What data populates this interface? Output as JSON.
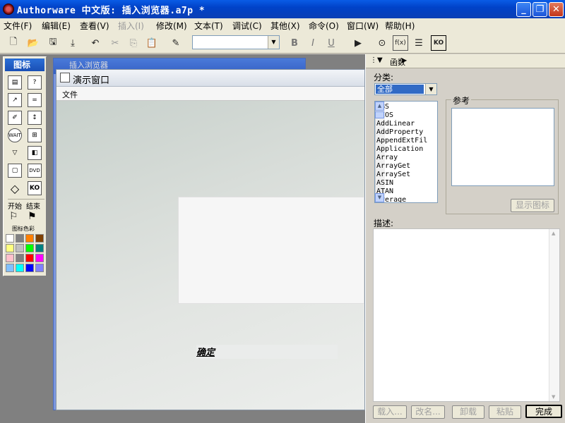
{
  "title": "Authorware 中文版: 插入浏览器.a7p *",
  "window_buttons": {
    "minimize": "_",
    "restore": "❐",
    "close": "✕"
  },
  "menus": [
    "文件(F)",
    "编辑(E)",
    "查看(V)",
    "插入(I)",
    "修改(M)",
    "文本(T)",
    "调试(C)",
    "其他(X)",
    "命令(O)",
    "窗口(W)",
    "帮助(H)"
  ],
  "toolbar": {
    "bold": "B",
    "italic": "I",
    "underline": "U",
    "font_value": ""
  },
  "palette": {
    "title": "图标",
    "start_label": "开始",
    "end_label": "结束",
    "color_label": "图标色彩",
    "swatches": [
      "#ffffff",
      "#808080",
      "#ff8000",
      "#804000",
      "#ffff80",
      "#c0c0c0",
      "#00ff00",
      "#008080",
      "#ffc0cb",
      "#808080",
      "#ff0000",
      "#ff00ff",
      "#80c0ff",
      "#00ffff",
      "#0000ff",
      "#8080ff"
    ]
  },
  "flow_window": {
    "title": "插入浏览器"
  },
  "presentation": {
    "title": "演示窗口",
    "menu_file": "文件",
    "button_label": "确定"
  },
  "functions_panel": {
    "header": "函数",
    "category_label": "分类:",
    "category_value": "全部",
    "reference_label": "参考",
    "show_icon_button": "显示图标",
    "description_label": "描述:",
    "functions": [
      "ABS",
      "ACOS",
      "AddLinear",
      "AddProperty",
      "AppendExtFil",
      "Application",
      "Array",
      "ArrayGet",
      "ArraySet",
      "ASIN",
      "ATAN",
      "Average"
    ],
    "buttons": {
      "load": "载入...",
      "rename": "改名...",
      "unload": "卸载",
      "paste": "粘贴",
      "done": "完成"
    }
  }
}
